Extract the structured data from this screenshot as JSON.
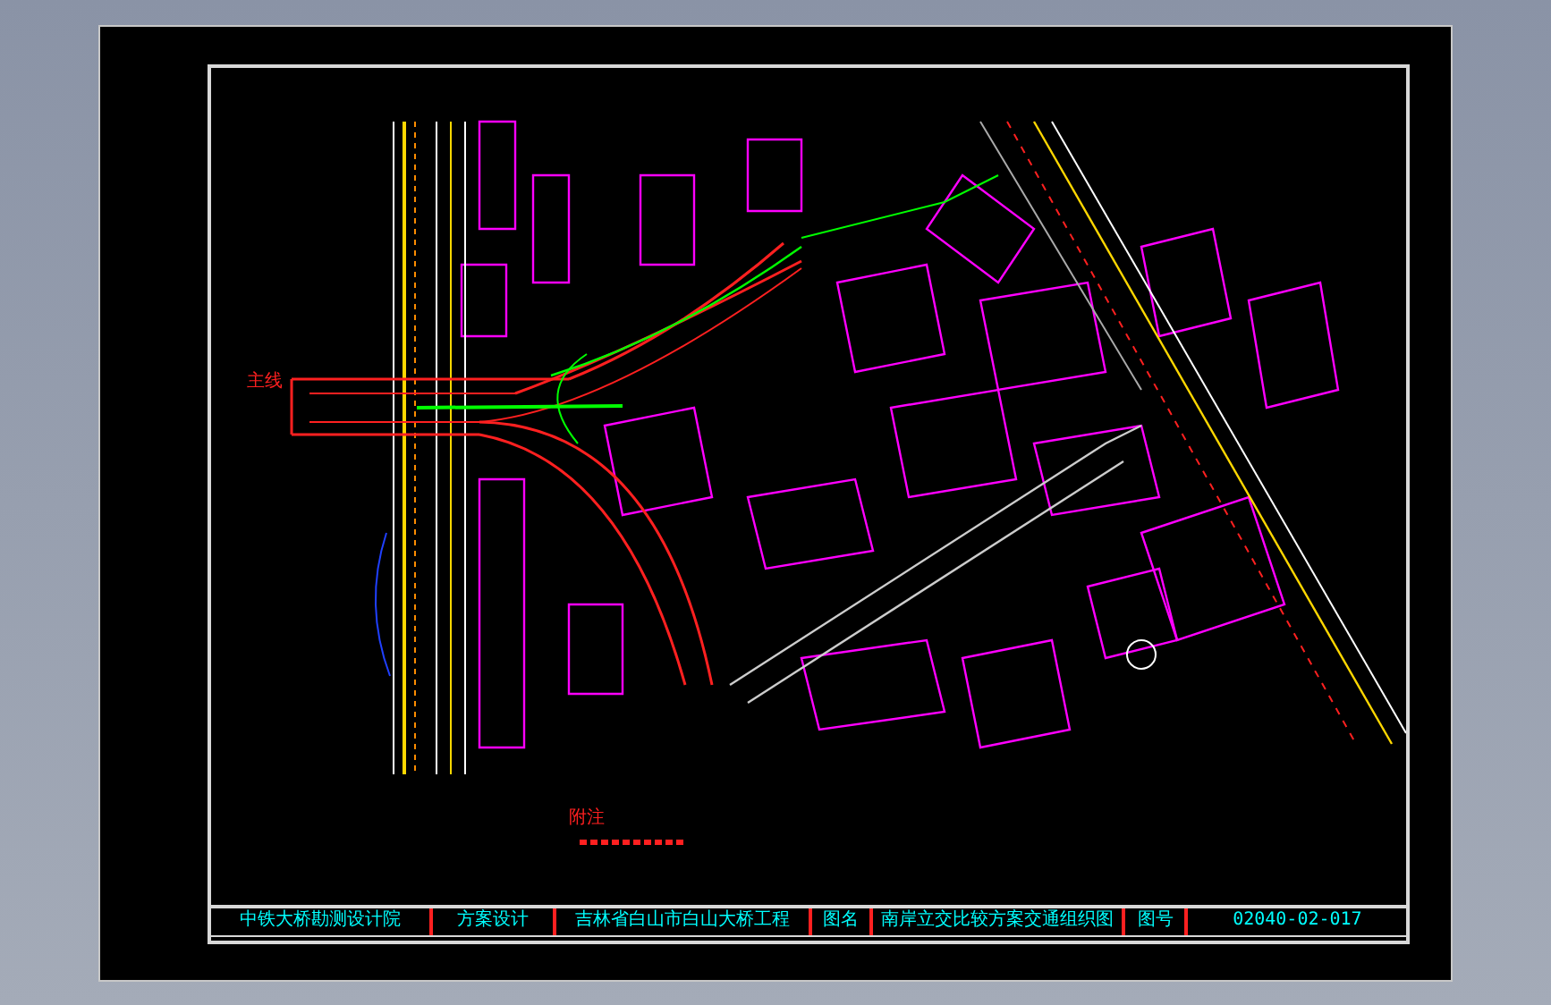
{
  "drawing": {
    "road_label": "主线",
    "note_heading": "附注"
  },
  "title_block": [
    {
      "kind": "label",
      "text": "中铁大桥勘测设计院"
    },
    {
      "kind": "label",
      "text": "方案设计"
    },
    {
      "kind": "label",
      "text": "吉林省白山市白山大桥工程"
    },
    {
      "kind": "label",
      "text": "图名"
    },
    {
      "kind": "label",
      "text": "南岸立交比较方案交通组织图"
    },
    {
      "kind": "label",
      "text": "图号"
    },
    {
      "kind": "value",
      "text": "02040-02-017"
    }
  ]
}
